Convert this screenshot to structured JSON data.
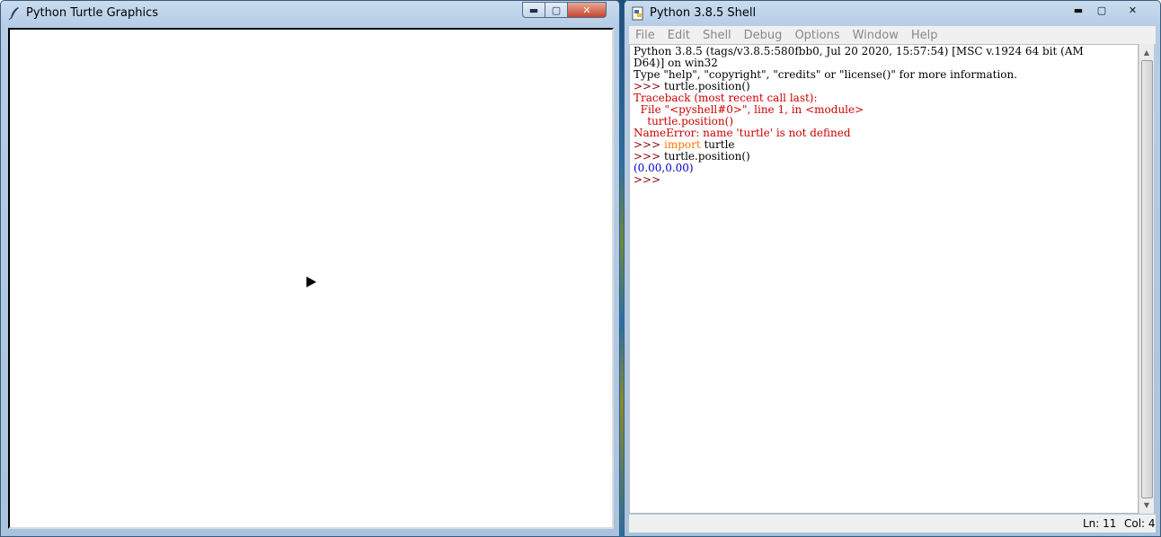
{
  "turtle_window": {
    "title": "Python Turtle Graphics",
    "buttons": {
      "minimize": "▬",
      "maximize": "▢",
      "close": "✕"
    }
  },
  "shell_window": {
    "title": "Python 3.8.5 Shell",
    "buttons": {
      "minimize": "▬",
      "maximize": "▢",
      "close": "✕"
    },
    "menu": [
      "File",
      "Edit",
      "Shell",
      "Debug",
      "Options",
      "Window",
      "Help"
    ],
    "lines": [
      [
        {
          "t": "Python 3.8.5 (tags/v3.8.5:580fbb0, Jul 20 2020, 15:57:54) [MSC v.1924 64 bit (AM",
          "c": "stdout"
        }
      ],
      [
        {
          "t": "D64)] on win32",
          "c": "stdout"
        }
      ],
      [
        {
          "t": "Type \"help\", \"copyright\", \"credits\" or \"license()\" for more information.",
          "c": "stdout"
        }
      ],
      [
        {
          "t": ">>> ",
          "c": "prompt"
        },
        {
          "t": "turtle.position()",
          "c": "stdout"
        }
      ],
      [
        {
          "t": "Traceback (most recent call last):",
          "c": "err"
        }
      ],
      [
        {
          "t": "  File \"<pyshell#0>\", line 1, in <module>",
          "c": "err"
        }
      ],
      [
        {
          "t": "    turtle.position()",
          "c": "err"
        }
      ],
      [
        {
          "t": "NameError: name 'turtle' is not defined",
          "c": "err"
        }
      ],
      [
        {
          "t": ">>> ",
          "c": "prompt"
        },
        {
          "t": "import",
          "c": "keyword"
        },
        {
          "t": " turtle",
          "c": "stdout"
        }
      ],
      [
        {
          "t": ">>> ",
          "c": "prompt"
        },
        {
          "t": "turtle.position()",
          "c": "stdout"
        }
      ],
      [
        {
          "t": "(0.00,0.00)",
          "c": "out"
        }
      ],
      [
        {
          "t": ">>> ",
          "c": "prompt"
        }
      ]
    ],
    "status": {
      "line": "Ln: 11",
      "col": "Col: 4"
    }
  },
  "colors": {
    "prompt": "#8b0000",
    "error": "#cc0000",
    "keyword": "#ff7700",
    "output": "#0000cc"
  }
}
